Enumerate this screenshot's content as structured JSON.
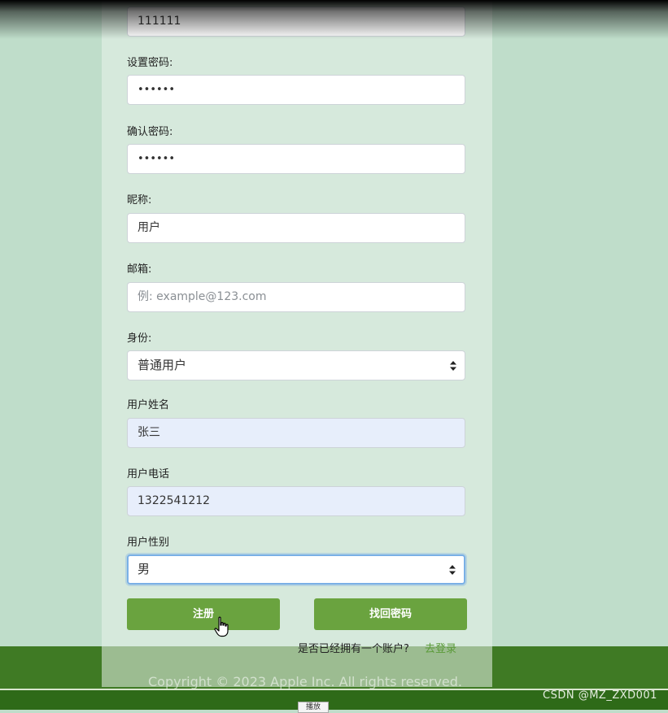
{
  "form": {
    "prev_value": "111111",
    "password": {
      "label": "设置密码:",
      "value": "••••••"
    },
    "confirm_password": {
      "label": "确认密码:",
      "value": "••••••"
    },
    "nickname": {
      "label": "昵称:",
      "value": "用户"
    },
    "email": {
      "label": "邮箱:",
      "placeholder": "例: example@123.com"
    },
    "identity": {
      "label": "身份:",
      "value": "普通用户"
    },
    "user_name": {
      "label": "用户姓名",
      "value": "张三"
    },
    "user_phone": {
      "label": "用户电话",
      "value": "1322541212"
    },
    "user_gender": {
      "label": "用户性别",
      "value": "男"
    }
  },
  "buttons": {
    "register": "注册",
    "recover": "找回密码"
  },
  "account_prompt": "是否已经拥有一个账户?",
  "login_link": "去登录",
  "footer": {
    "copyright": "Copyright © 2023 Apple Inc. All rights reserved."
  },
  "watermark": "CSDN @MZ_ZXD001",
  "tooltip": "播放",
  "colors": {
    "page_bg": "#bfddca",
    "button_green": "#6aa33f",
    "footer_green": "#3f7a24",
    "autofill_blue": "#e7eefb",
    "focus_blue": "#7ab0e6"
  }
}
